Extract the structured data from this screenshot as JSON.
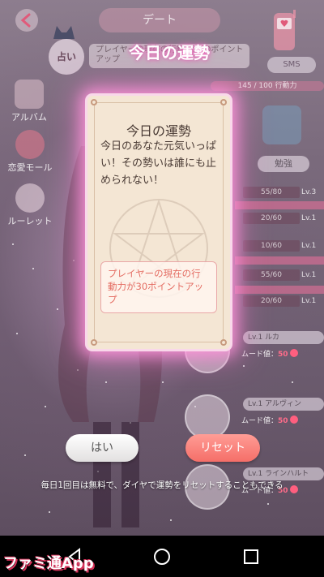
{
  "header": {
    "date_tab": "デート",
    "uranai_label": "占い",
    "fortune_pill_text": "プレイヤーの現在の行動力が30ポイントアップ",
    "fortune_title": "今日の運勢",
    "sms_label": "SMS",
    "action_points": "145 / 100 行動力"
  },
  "side_menu": {
    "album": "アルバム",
    "mall": "恋愛モール",
    "roulette": "ルーレット"
  },
  "study_label": "勉強",
  "stats": [
    {
      "value": "55/80",
      "level": "Lv.3"
    },
    {
      "value": "20/60",
      "level": "Lv.1"
    },
    {
      "value": "10/60",
      "level": "Lv.1"
    },
    {
      "value": "55/60",
      "level": "Lv.1"
    },
    {
      "value": "20/60",
      "level": "Lv.1"
    }
  ],
  "characters": [
    {
      "name": "Lv.1 ルカ",
      "mood_label": "ムード値：",
      "mood_value": "50"
    },
    {
      "name": "Lv.1 アルヴィン",
      "mood_label": "ムード値：",
      "mood_value": "50"
    },
    {
      "name": "Lv.1 ラインハルト",
      "mood_label": "ムード値：",
      "mood_value": "50"
    }
  ],
  "dialog": {
    "title": "今日の運勢",
    "body": "今日のあなた元気いっぱい！その勢いは誰にも止められない！",
    "effect": "プレイヤーの現在の行動力が30ポイントアップ"
  },
  "buttons": {
    "yes": "はい",
    "reset": "リセット"
  },
  "note": "毎日1回目は無料で、ダイヤで運勢をリセットすることもできる",
  "watermark": "ファミ通App",
  "colors": {
    "reset_button": "#f56e68",
    "effect_text": "#e46d63",
    "dialog_bg": "#f4e6d4",
    "glow": "#ff96dc"
  }
}
